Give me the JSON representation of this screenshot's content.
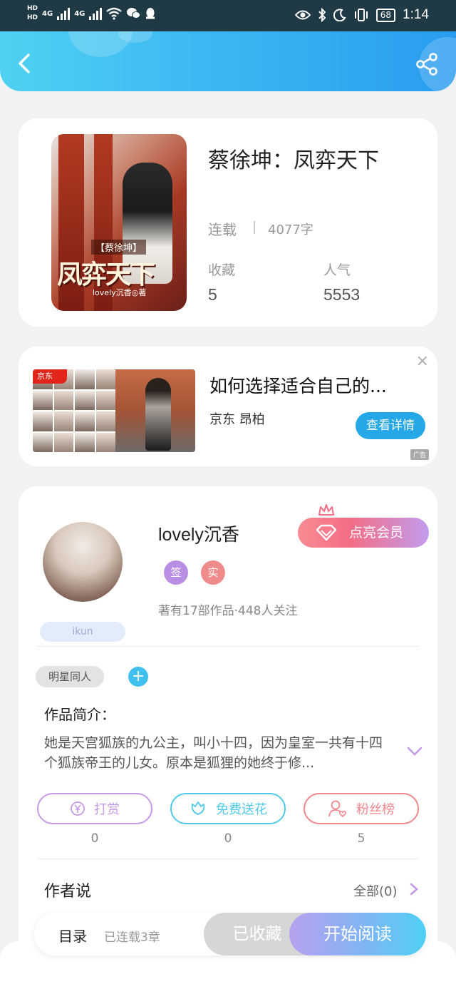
{
  "status_bar": {
    "left_labels": [
      "HD",
      "HD",
      "4G",
      "4G"
    ],
    "battery": "68",
    "time": "1:14"
  },
  "book": {
    "title": "蔡徐坤：凤弈天下",
    "status": "连载",
    "word_count": "4077字",
    "favorites_label": "收藏",
    "favorites_value": "5",
    "popularity_label": "人气",
    "popularity_value": "5553",
    "cover_text": {
      "title": "凤弈天下",
      "subtitle": "【蔡徐坤】",
      "author": "lovely沉香◎著"
    }
  },
  "ad": {
    "logo": "京东",
    "title": "如何选择适合自己的...",
    "source": "京东 昂柏",
    "button": "查看详情",
    "close": "×",
    "badge": "广告"
  },
  "author": {
    "name": "lovely沉香",
    "badge": "ikun",
    "tag_sign": "签",
    "tag_real": "实",
    "meta": "著有17部作品·448人关注",
    "vip_button": "点亮会员",
    "genre_tag": "明星同人",
    "add_tag": "+",
    "intro_label": "作品简介：",
    "intro_text": "她是天宫狐族的九公主，叫小十四，因为皇室一共有十四个狐族帝王的儿女。原本是狐狸的她终于修...",
    "actions": [
      {
        "label": "打赏",
        "count": "0",
        "icon": "yen-coin-icon",
        "color": "#c59ae8"
      },
      {
        "label": "免费送花",
        "count": "0",
        "icon": "flower-icon",
        "color": "#4fc9e8"
      },
      {
        "label": "粉丝榜",
        "count": "5",
        "icon": "fan-user-icon",
        "color": "#f2878d"
      }
    ],
    "says_label": "作者说",
    "says_all": "全部(0)"
  },
  "bottom_bar": {
    "toc": "目录",
    "toc_count": "已连载3章",
    "collected": "已收藏",
    "read": "开始阅读"
  },
  "colors": {
    "header_gradient": [
      "#4fd1f2",
      "#2a9cf0"
    ],
    "accent_blue": "#26a8e8",
    "vip_pink": "#f46d85",
    "tag_purple": "#b98fe6",
    "tag_red": "#f08b8b"
  }
}
